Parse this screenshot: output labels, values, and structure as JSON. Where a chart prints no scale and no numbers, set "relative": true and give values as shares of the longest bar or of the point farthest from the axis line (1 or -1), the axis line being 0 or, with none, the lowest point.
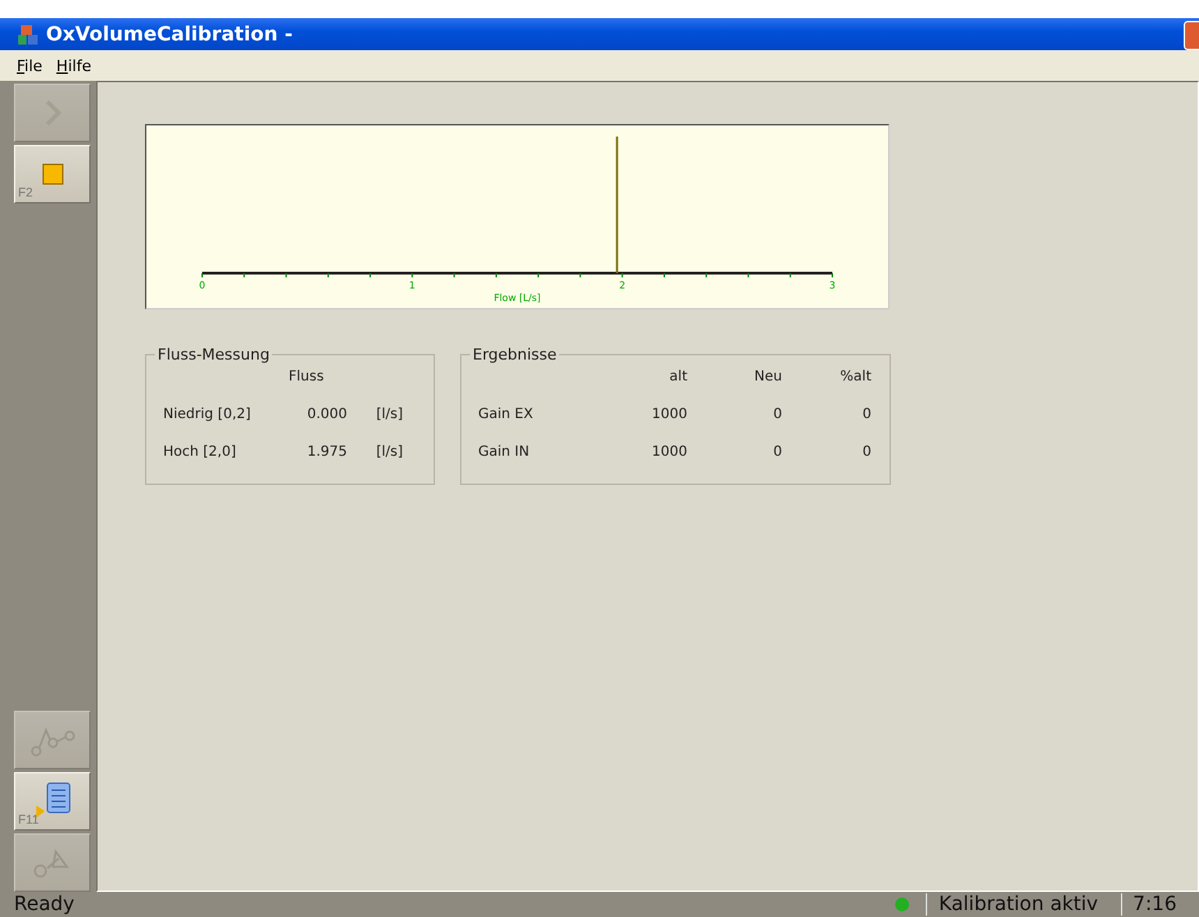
{
  "window": {
    "title": "OxVolumeCalibration -"
  },
  "menu": [
    {
      "label": "File"
    },
    {
      "label": "Hilfe"
    }
  ],
  "toolbar": [
    {
      "kind": "play",
      "disabled": true
    },
    {
      "kind": "stop",
      "key": "F2",
      "disabled": false
    },
    {
      "kind": "graph",
      "disabled": true
    },
    {
      "kind": "list",
      "key": "F11",
      "disabled": false
    },
    {
      "kind": "tool",
      "disabled": true
    }
  ],
  "chart": {
    "chart_data": {
      "type": "bar",
      "xlabel": "Flow [L/s]",
      "xlim": [
        0,
        3
      ],
      "xticks": [
        0,
        1,
        2,
        3
      ],
      "x": [
        1.975
      ],
      "values": [
        1
      ],
      "relative": true
    }
  },
  "flow_group": {
    "title": "Fluss-Messung",
    "column": "Fluss",
    "rows": [
      {
        "label": "Niedrig [0,2]",
        "value": "0.000",
        "unit": "[l/s]"
      },
      {
        "label": "Hoch [2,0]",
        "value": "1.975",
        "unit": "[l/s]"
      }
    ]
  },
  "results_group": {
    "title": "Ergebnisse",
    "columns": [
      "alt",
      "Neu",
      "%alt"
    ],
    "rows": [
      {
        "label": "Gain EX",
        "values": [
          "1000",
          "0",
          "0"
        ]
      },
      {
        "label": "Gain IN",
        "values": [
          "1000",
          "0",
          "0"
        ]
      }
    ]
  },
  "status_bar": {
    "left": "Ready",
    "indicator_on": true,
    "status": "Kalibration aktiv",
    "time": "7:16"
  }
}
